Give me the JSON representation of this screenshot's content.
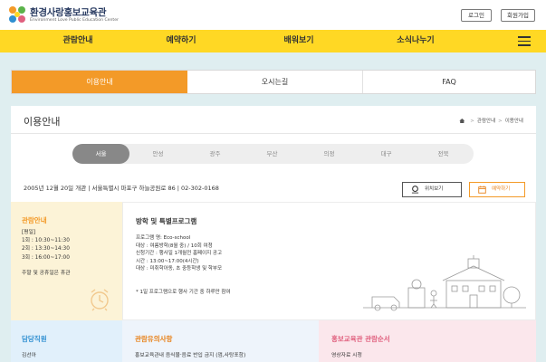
{
  "header": {
    "logo_title": "환경사랑홍보교육관",
    "logo_subtitle": "Environment Love Public Education Center",
    "login_label": "로그인",
    "join_label": "회원가입"
  },
  "nav": {
    "items": [
      {
        "label": "관람안내"
      },
      {
        "label": "예약하기"
      },
      {
        "label": "배워보기"
      },
      {
        "label": "소식나누기"
      }
    ]
  },
  "tabs": [
    {
      "label": "이용안내",
      "active": true
    },
    {
      "label": "오시는길",
      "active": false
    },
    {
      "label": "FAQ",
      "active": false
    }
  ],
  "page": {
    "title": "이용안내",
    "breadcrumb": [
      "관람안내",
      "이용안내"
    ]
  },
  "regions": [
    {
      "label": "서울",
      "active": true
    },
    {
      "label": "안성"
    },
    {
      "label": "광주"
    },
    {
      "label": "부산"
    },
    {
      "label": "의정"
    },
    {
      "label": "대구"
    },
    {
      "label": "전북"
    }
  ],
  "address": {
    "text": "2005년 12월 20일 개관 | 서울특별시 마포구 하늘공원로 86 | 02-302-0168",
    "map_label": "위치보기",
    "reserve_label": "예약하기"
  },
  "hours": {
    "heading": "관람안내",
    "lines": [
      "[평일]",
      "1회 : 10:30~11:30",
      "2회 : 13:30~14:30",
      "3회 : 16:00~17:00"
    ],
    "note": "주말 및 공휴일은 휴관"
  },
  "program": {
    "title": "방학 및 특별프로그램",
    "lines": [
      "프로그램 명: Eco-school",
      "대상 : 여름방학(8월 중) / 10회 여청",
      "신청기간 : 행사일 1개월전 홈페이지 공고",
      "시간 : 13:00~17:00(4시간)",
      "대상 : 미취학아동, 초 중등학생 및 학부모"
    ],
    "note": "* 1일 프로그램으로 행사 기간 중 하루만 참여"
  },
  "staff": {
    "heading": "담당직원",
    "text": "김선아"
  },
  "notice": {
    "heading": "관람유의사항",
    "text": "홍보교육관내 음식물·음료 반입 금지 (껌,사탕포함)"
  },
  "rules": {
    "heading": "홍보교육관 관람순서",
    "text": "영상자료 시청"
  },
  "colors": {
    "accent_orange": "#f39a28",
    "nav_yellow": "#ffd824",
    "background": "#dfeef0"
  }
}
